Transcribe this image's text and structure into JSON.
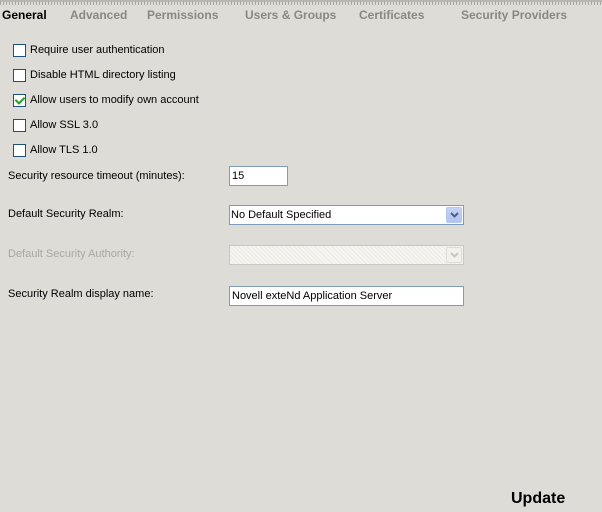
{
  "tabs": [
    {
      "label": "General",
      "active": true
    },
    {
      "label": "Advanced",
      "active": false
    },
    {
      "label": "Permissions",
      "active": false
    },
    {
      "label": "Users & Groups",
      "active": false
    },
    {
      "label": "Certificates",
      "active": false
    },
    {
      "label": "Security Providers",
      "active": false
    }
  ],
  "checkboxes": [
    {
      "label": "Require user authentication",
      "checked": false
    },
    {
      "label": "Disable HTML directory listing",
      "checked": false
    },
    {
      "label": "Allow users to modify own account",
      "checked": true
    },
    {
      "label": "Allow SSL 3.0",
      "checked": false
    },
    {
      "label": "Allow TLS 1.0",
      "checked": false
    }
  ],
  "fields": {
    "timeout": {
      "label": "Security resource timeout (minutes):",
      "value": "15"
    },
    "realm": {
      "label": "Default Security Realm:",
      "value": "No Default Specified"
    },
    "authority": {
      "label": "Default Security Authority:",
      "value": "",
      "disabled": true
    },
    "display_name": {
      "label": "Security Realm display name:",
      "value": "Novell exteNd Application Server"
    }
  },
  "update_label": "Update",
  "colors": {
    "background": "#dedcd6",
    "inactive_tab": "#8a8884",
    "check": "#21a121",
    "input_border": "#7f9db9",
    "disabled_text": "#a9a7a1"
  }
}
